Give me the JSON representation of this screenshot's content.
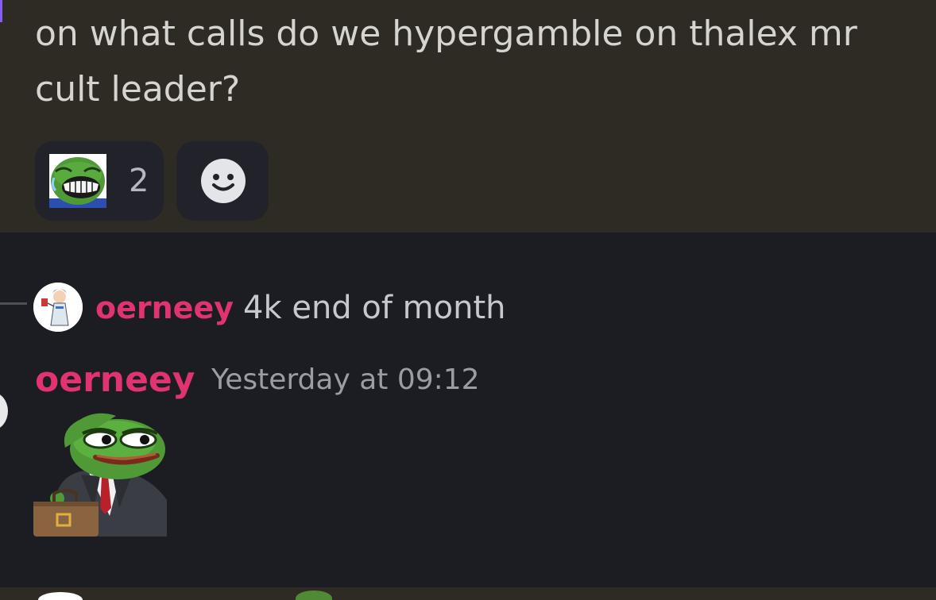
{
  "highlighted_message": {
    "text": "on what calls do we hypergamble on thalex mr cult leader?",
    "reactions": [
      {
        "icon": "laughing-pepe-emoji",
        "count": "2"
      }
    ],
    "add_reaction_icon": "smiley-face-icon"
  },
  "reply": {
    "author": "oerneey",
    "preview": "4k end of month",
    "avatar_icon": "anime-character-avatar"
  },
  "message": {
    "author": "oerneey",
    "timestamp": "Yesterday at 09:12",
    "sticker": "business-pepe-with-briefcase-sticker"
  },
  "colors": {
    "highlight_bg": "#2e2a24",
    "chat_bg": "#1c1d22",
    "username": "#e0336f",
    "text": "#d6d4d0",
    "muted": "#9a9ca6"
  }
}
